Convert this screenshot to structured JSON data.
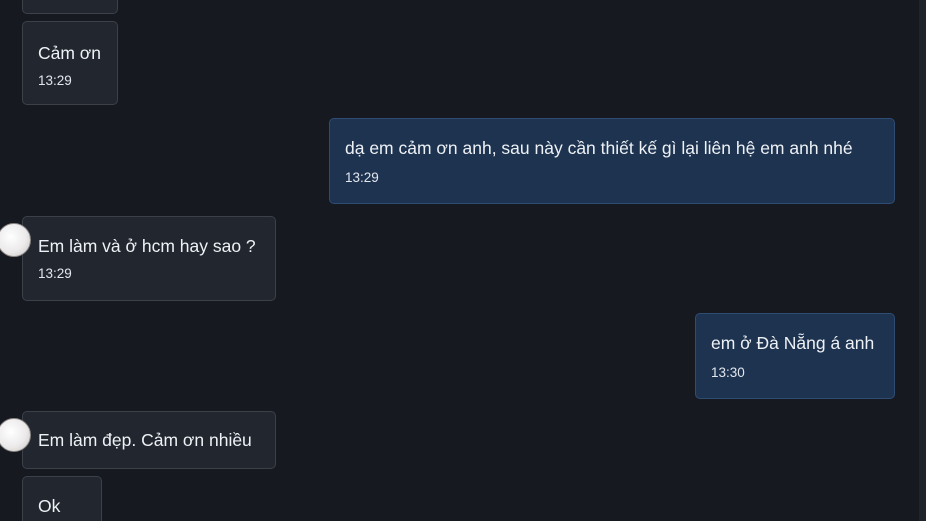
{
  "messages": [
    {
      "direction": "incoming",
      "text": "",
      "time": ""
    },
    {
      "direction": "incoming",
      "text": "Cảm ơn",
      "time": "13:29"
    },
    {
      "direction": "outgoing",
      "text": "dạ em cảm ơn anh, sau này cần thiết kế gì lại liên hệ em anh nhé",
      "time": "13:29"
    },
    {
      "direction": "incoming",
      "text": "Em làm và ở hcm hay sao ?",
      "time": "13:29"
    },
    {
      "direction": "outgoing",
      "text": "em ở Đà Nẵng á anh",
      "time": "13:30"
    },
    {
      "direction": "incoming",
      "text": "Em làm đẹp. Cảm ơn nhiều",
      "time": ""
    },
    {
      "direction": "incoming",
      "text": "Ok",
      "time": ""
    }
  ],
  "colors": {
    "background": "#16191f",
    "incoming_bubble": "#22262e",
    "outgoing_bubble": "#1d3350",
    "text": "#eef1f5"
  },
  "icons": {
    "avatar": "sender-avatar"
  }
}
